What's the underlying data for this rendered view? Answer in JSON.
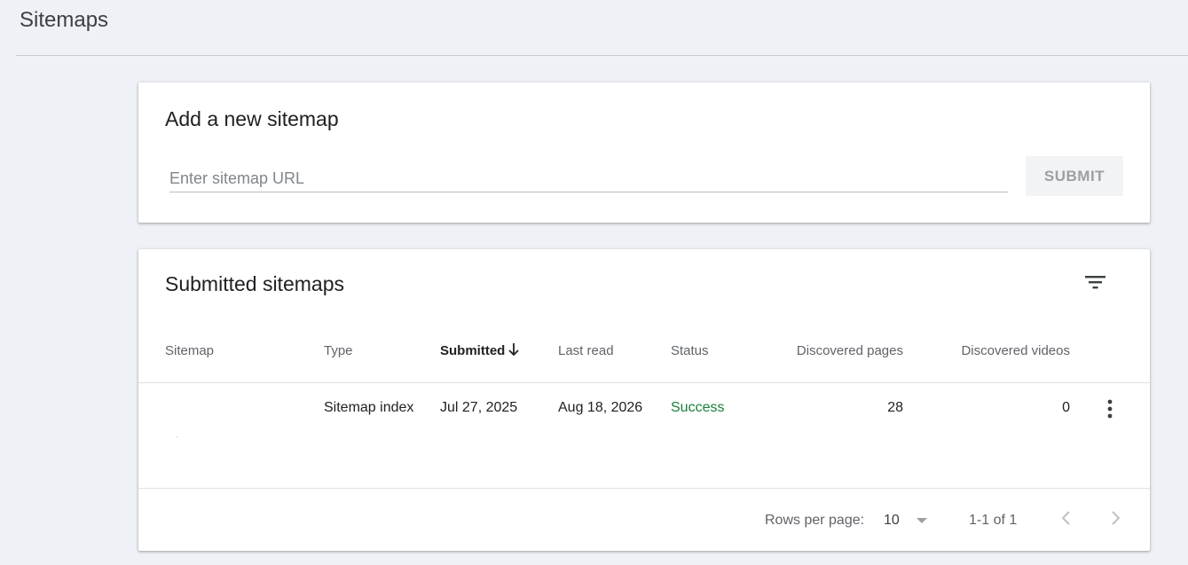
{
  "page": {
    "title": "Sitemaps"
  },
  "add_card": {
    "title": "Add a new sitemap",
    "input_placeholder": "Enter sitemap URL",
    "input_value": "",
    "submit_label": "SUBMIT"
  },
  "submitted_card": {
    "title": "Submitted sitemaps",
    "filter_icon": "filter-icon",
    "columns": {
      "sitemap": "Sitemap",
      "type": "Type",
      "submitted": "Submitted",
      "last_read": "Last read",
      "status": "Status",
      "discovered_pages": "Discovered pages",
      "discovered_videos": "Discovered videos"
    },
    "sort": {
      "column": "submitted",
      "direction": "descending"
    },
    "rows": [
      {
        "sitemap": "",
        "type": "Sitemap index",
        "submitted": "Jul 27, 2025",
        "last_read": "Aug 18, 2026",
        "status": "Success",
        "discovered_pages": "28",
        "discovered_videos": "0"
      }
    ],
    "pagination": {
      "rows_per_page_label": "Rows per page:",
      "rows_per_page_value": "10",
      "range_label": "1-1 of 1"
    }
  },
  "colors": {
    "background": "#eef1f5",
    "success": "#188038",
    "muted_text": "#5f6368",
    "disabled_button_bg": "#f1f3f4",
    "disabled_button_text": "#9aa0a6"
  }
}
